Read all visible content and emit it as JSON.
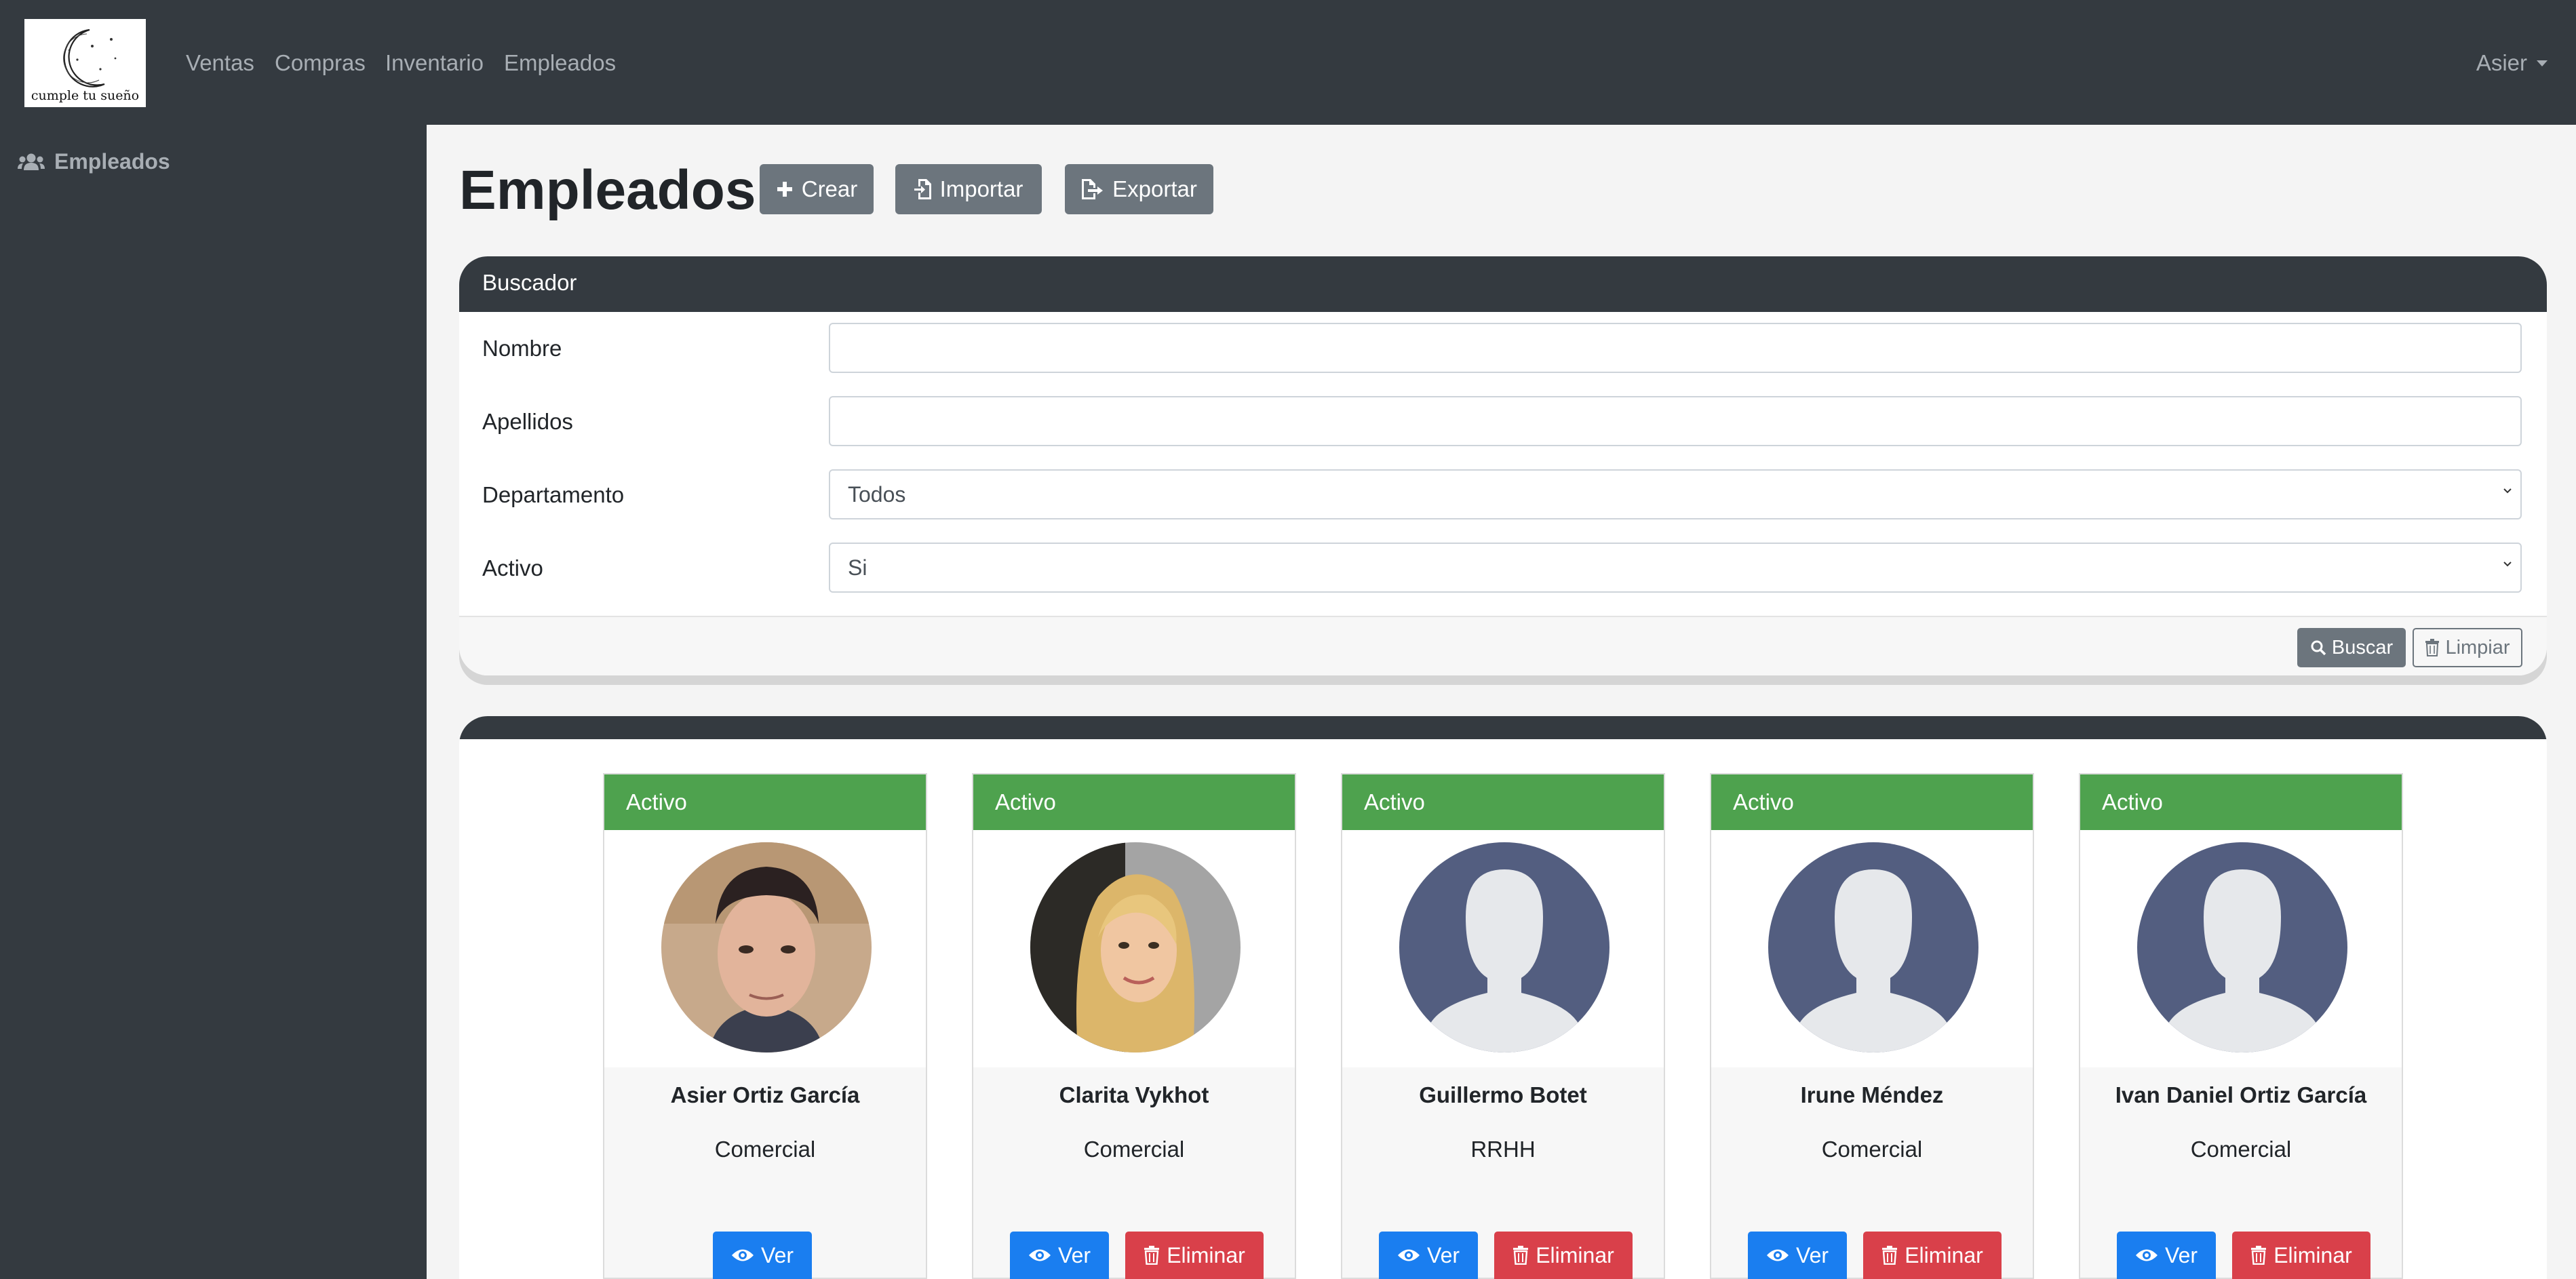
{
  "brand": {
    "logo_text": "cumple tu sueño"
  },
  "nav": {
    "items": [
      {
        "label": "Ventas"
      },
      {
        "label": "Compras"
      },
      {
        "label": "Inventario"
      },
      {
        "label": "Empleados"
      }
    ],
    "user": "Asier"
  },
  "sidebar": {
    "items": [
      {
        "label": "Empleados",
        "icon": "users-icon"
      }
    ]
  },
  "page": {
    "title": "Empleados",
    "actions": {
      "create": "Crear",
      "import": "Importar",
      "export": "Exportar"
    }
  },
  "search": {
    "header": "Buscador",
    "fields": {
      "nombre": {
        "label": "Nombre",
        "value": ""
      },
      "apellidos": {
        "label": "Apellidos",
        "value": ""
      },
      "departamento": {
        "label": "Departamento",
        "value": "Todos"
      },
      "activo": {
        "label": "Activo",
        "value": "Si"
      }
    },
    "search_button": "Buscar",
    "clear_button": "Limpiar"
  },
  "employees": [
    {
      "status": "Activo",
      "name": "Asier Ortiz García",
      "department": "Comercial",
      "view": "Ver",
      "delete": ""
    },
    {
      "status": "Activo",
      "name": "Clarita Vykhot",
      "department": "Comercial",
      "view": "Ver",
      "delete": "Eliminar"
    },
    {
      "status": "Activo",
      "name": "Guillermo Botet",
      "department": "RRHH",
      "view": "Ver",
      "delete": "Eliminar"
    },
    {
      "status": "Activo",
      "name": "Irune Méndez",
      "department": "Comercial",
      "view": "Ver",
      "delete": "Eliminar"
    },
    {
      "status": "Activo",
      "name": "Ivan Daniel Ortiz García",
      "department": "Comercial",
      "view": "Ver",
      "delete": "Eliminar"
    }
  ],
  "colors": {
    "navbar": "#343a40",
    "status_active": "#4ea24e",
    "btn_view": "#1a7ef0",
    "btn_delete": "#d9404a",
    "btn_secondary": "#6c757d",
    "avatar_placeholder": "#535e80"
  }
}
